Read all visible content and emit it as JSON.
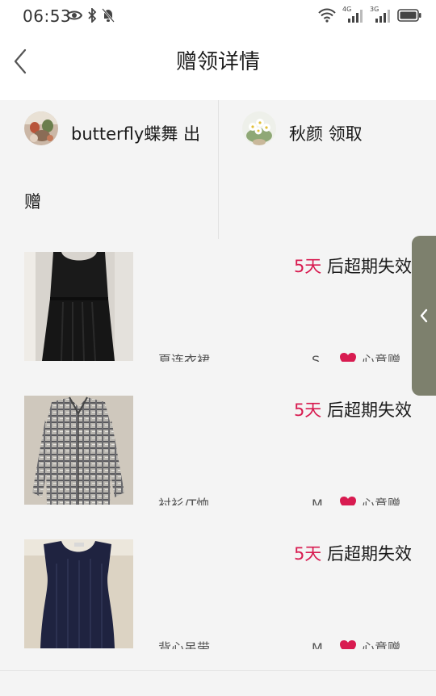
{
  "status_bar": {
    "time": "06:53",
    "icons_left": [
      "eye-icon",
      "bluetooth-icon",
      "bell-off-icon"
    ],
    "icons_right": [
      "wifi-icon",
      "signal-4g-icon",
      "signal-3g-icon",
      "battery-icon"
    ],
    "net_label_1": "4G",
    "net_label_2": "3G"
  },
  "header": {
    "title": "赠领详情",
    "back_icon": "chevron-left-icon"
  },
  "parties": {
    "giver": {
      "name": "butterfly蝶舞",
      "action_line1": "出",
      "action_line2": "赠"
    },
    "receiver": {
      "name": "秋颜",
      "action": "领取"
    }
  },
  "items": [
    {
      "expiry_days": "5天",
      "expiry_text": " 后超期失效",
      "name": "夏连衣裙",
      "size": "S",
      "tag": "心意赠",
      "image": "black-dress"
    },
    {
      "expiry_days": "5天",
      "expiry_text": " 后超期失效",
      "name": "衬衫/T恤",
      "size": "M",
      "tag": "心意赠",
      "image": "plaid-shirt"
    },
    {
      "expiry_days": "5天",
      "expiry_text": " 后超期失效",
      "name": "背心吊带",
      "size": "M",
      "tag": "心意赠",
      "image": "navy-vest"
    }
  ],
  "colors": {
    "accent_red": "#d81b50",
    "side_handle": "#7d806d",
    "background": "#f4f4f4"
  }
}
